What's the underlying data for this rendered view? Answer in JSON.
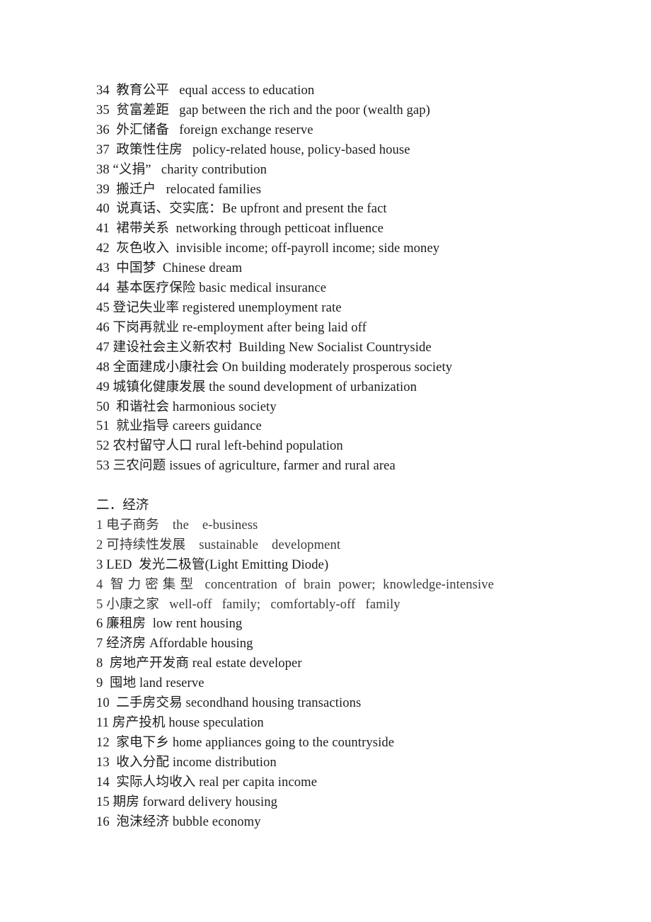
{
  "document": {
    "page_background": "#ffffff",
    "text_color": "#1c1c1c",
    "section_one_entries": [
      {
        "num": "34",
        "text": "34  教育公平   equal access to education"
      },
      {
        "num": "35",
        "text": "35  贫富差距   gap between the rich and the poor (wealth gap)"
      },
      {
        "num": "36",
        "text": "36  外汇储备   foreign exchange reserve"
      },
      {
        "num": "37",
        "text": "37  政策性住房   policy-related house, policy-based house"
      },
      {
        "num": "38",
        "text": "38 “义捐”   charity contribution"
      },
      {
        "num": "39",
        "text": "39  搬迁户   relocated families"
      },
      {
        "num": "40",
        "text": "40  说真话、交实底：Be upfront and present the fact"
      },
      {
        "num": "41",
        "text": "41  裙带关系  networking through petticoat influence"
      },
      {
        "num": "42",
        "text": "42  灰色收入  invisible income; off-payroll income; side money"
      },
      {
        "num": "43",
        "text": "43  中国梦  Chinese dream"
      },
      {
        "num": "44",
        "text": "44  基本医疗保险 basic medical insurance"
      },
      {
        "num": "45",
        "text": "45 登记失业率 registered unemployment rate"
      },
      {
        "num": "46",
        "text": "46 下岗再就业 re-employment after being laid off"
      },
      {
        "num": "47",
        "text": "47 建设社会主义新农村  Building New Socialist Countryside"
      },
      {
        "num": "48",
        "text": "48 全面建成小康社会 On building moderately prosperous society"
      },
      {
        "num": "49",
        "text": "49 城镇化健康发展 the sound development of urbanization"
      },
      {
        "num": "50",
        "text": "50  和谐社会 harmonious society"
      },
      {
        "num": "51",
        "text": "51  就业指导 careers guidance"
      },
      {
        "num": "52",
        "text": "52 农村留守人口 rural left-behind population"
      },
      {
        "num": "53",
        "text": "53 三农问题 issues of agriculture, farmer and rural area"
      }
    ],
    "section_two_heading": "二．经济",
    "section_two_entries": [
      {
        "num": "1",
        "text": "1 电子商务    the    e-business",
        "style": "light",
        "justify": "none"
      },
      {
        "num": "2",
        "text": "2 可持续性发展    sustainable    development",
        "style": "light",
        "justify": "none"
      },
      {
        "num": "3",
        "text": "3 LED  发光二极管(Light Emitting Diode)",
        "style": "normal",
        "justify": "none"
      },
      {
        "num": "4",
        "text": "4 智力密集型  concentration of brain power; knowledge-intensive",
        "style": "light",
        "justify": "full"
      },
      {
        "num": "5",
        "text": "5 小康之家   well-off   family;   comfortably-off   family",
        "style": "light",
        "justify": "none"
      },
      {
        "num": "6",
        "text": "6 廉租房  low rent housing",
        "style": "normal",
        "justify": "none"
      },
      {
        "num": "7",
        "text": "7 经济房 Affordable housing",
        "style": "normal",
        "justify": "none"
      },
      {
        "num": "8",
        "text": "8  房地产开发商 real estate developer",
        "style": "normal",
        "justify": "none"
      },
      {
        "num": "9",
        "text": "9  囤地 land reserve",
        "style": "normal",
        "justify": "none"
      },
      {
        "num": "10",
        "text": "10  二手房交易 secondhand housing transactions",
        "style": "normal",
        "justify": "none"
      },
      {
        "num": "11",
        "text": "11 房产投机 house speculation",
        "style": "normal",
        "justify": "none"
      },
      {
        "num": "12",
        "text": "12  家电下乡 home appliances going to the countryside",
        "style": "normal",
        "justify": "none"
      },
      {
        "num": "13",
        "text": "13  收入分配 income distribution",
        "style": "normal",
        "justify": "none"
      },
      {
        "num": "14",
        "text": "14  实际人均收入 real per capita income",
        "style": "normal",
        "justify": "none"
      },
      {
        "num": "15",
        "text": "15 期房 forward delivery housing",
        "style": "normal",
        "justify": "none"
      },
      {
        "num": "16",
        "text": "16  泡沫经济 bubble economy",
        "style": "normal",
        "justify": "none"
      }
    ]
  }
}
